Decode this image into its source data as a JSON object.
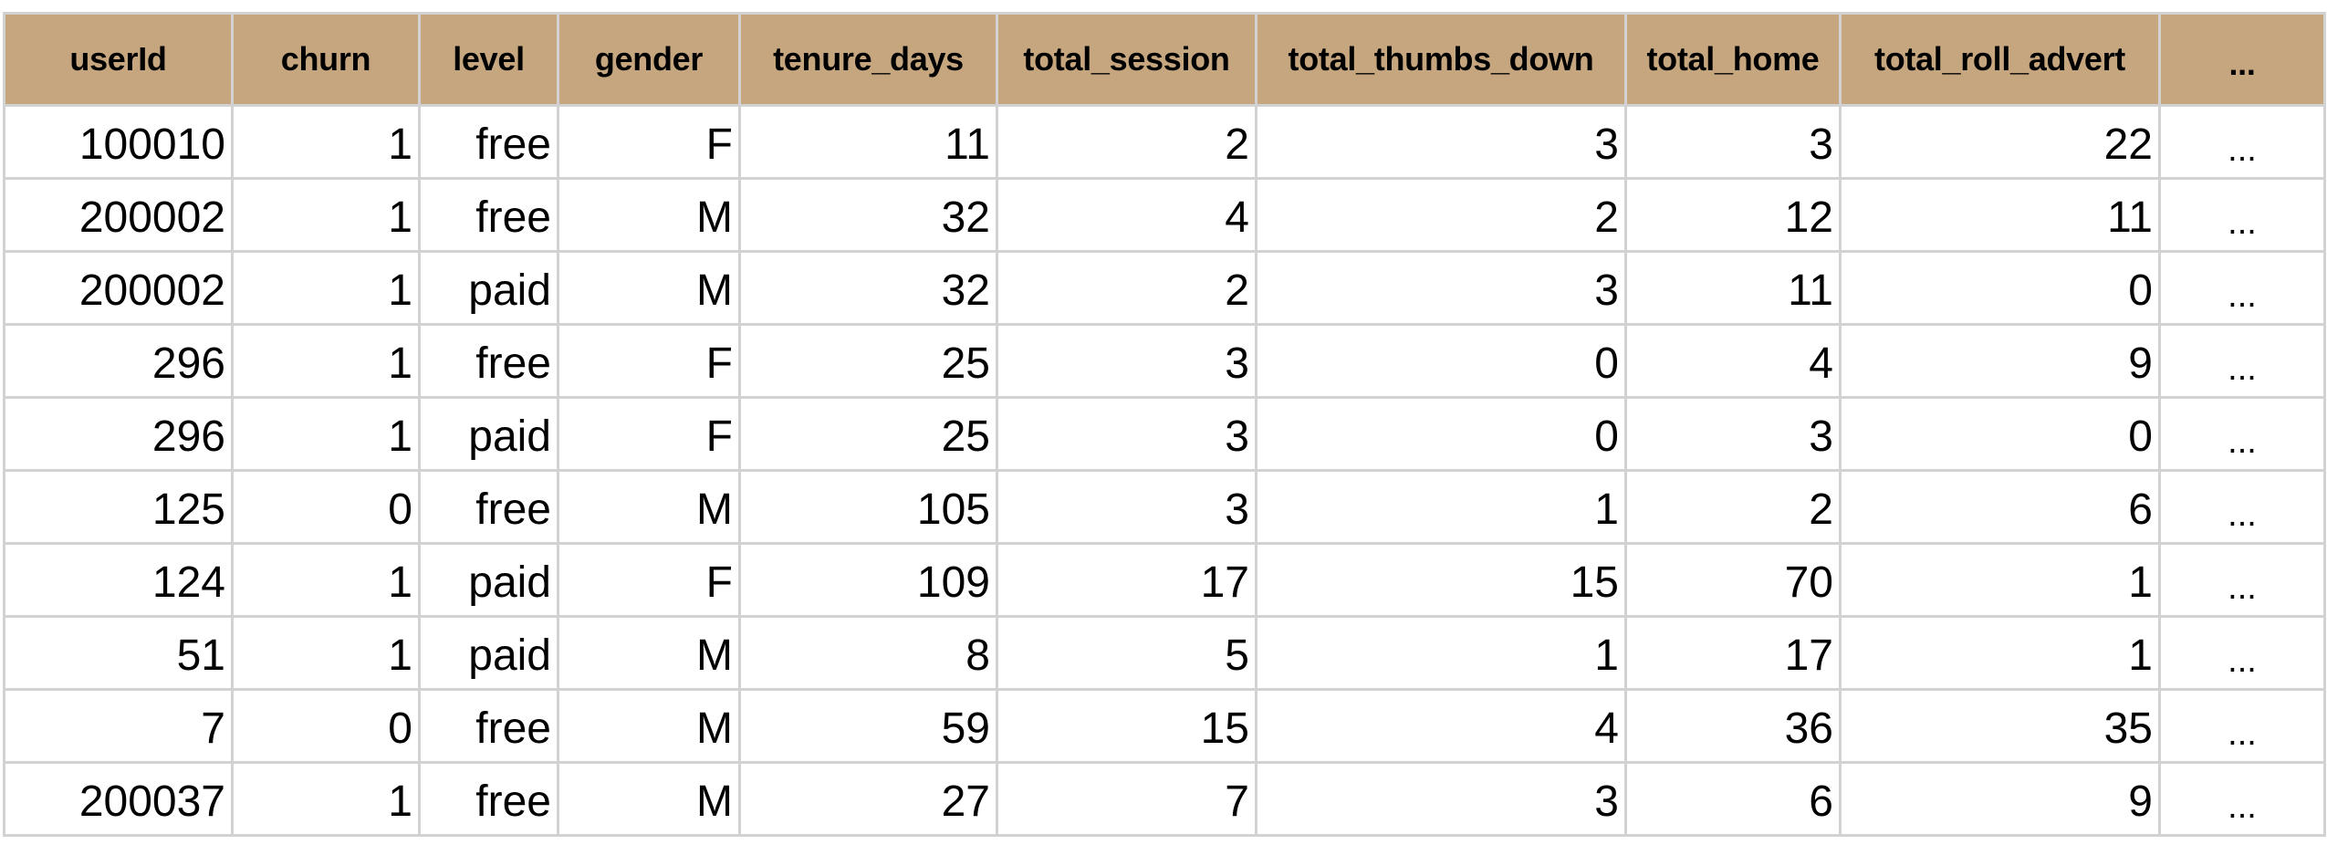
{
  "table": {
    "header_color": "#c6a67e",
    "border_color": "#d2d2d2",
    "columns": [
      "userId",
      "churn",
      "level",
      "gender",
      "tenure_days",
      "total_session",
      "total_thumbs_down",
      "total_home",
      "total_roll_advert",
      "..."
    ],
    "rows": [
      [
        "100010",
        "1",
        "free",
        "F",
        "11",
        "2",
        "3",
        "3",
        "22",
        "..."
      ],
      [
        "200002",
        "1",
        "free",
        "M",
        "32",
        "4",
        "2",
        "12",
        "11",
        "..."
      ],
      [
        "200002",
        "1",
        "paid",
        "M",
        "32",
        "2",
        "3",
        "11",
        "0",
        "..."
      ],
      [
        "296",
        "1",
        "free",
        "F",
        "25",
        "3",
        "0",
        "4",
        "9",
        "..."
      ],
      [
        "296",
        "1",
        "paid",
        "F",
        "25",
        "3",
        "0",
        "3",
        "0",
        "..."
      ],
      [
        "125",
        "0",
        "free",
        "M",
        "105",
        "3",
        "1",
        "2",
        "6",
        "..."
      ],
      [
        "124",
        "1",
        "paid",
        "F",
        "109",
        "17",
        "15",
        "70",
        "1",
        "..."
      ],
      [
        "51",
        "1",
        "paid",
        "M",
        "8",
        "5",
        "1",
        "17",
        "1",
        "..."
      ],
      [
        "7",
        "0",
        "free",
        "M",
        "59",
        "15",
        "4",
        "36",
        "35",
        "..."
      ],
      [
        "200037",
        "1",
        "free",
        "M",
        "27",
        "7",
        "3",
        "6",
        "9",
        "..."
      ]
    ]
  }
}
